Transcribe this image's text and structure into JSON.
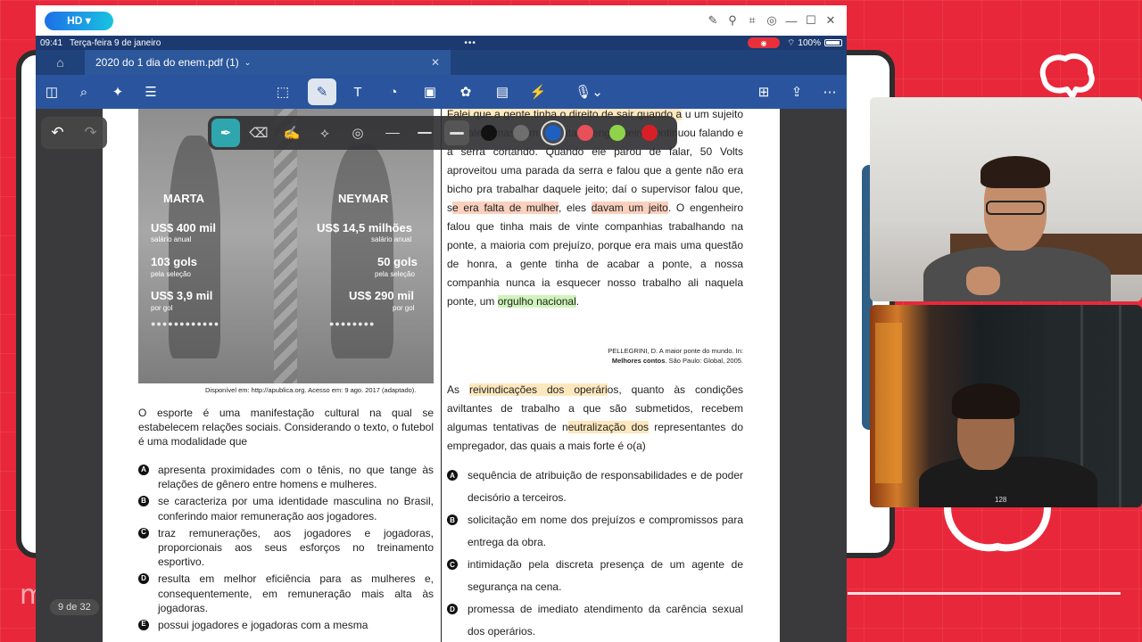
{
  "window": {
    "hd_badge": "HD ▾"
  },
  "statusbar": {
    "time": "09:41",
    "date": "Terça-feira 9 de janeiro",
    "battery": "100%"
  },
  "tab": {
    "title": "2020 do 1 dia do enem.pdf (1)"
  },
  "page_indicator": "9 de 32",
  "figure": {
    "left_name": "MARTA",
    "right_name": "NEYMAR",
    "left_salary": "US$ 400 mil",
    "left_salary_sub": "salário anual",
    "left_goals": "103 gols",
    "left_goals_sub": "pela seleção",
    "left_per_goal": "US$ 3,9 mil",
    "left_per_goal_sub": "por gol",
    "right_salary": "US$ 14,5 milhões",
    "right_salary_sub": "salário anual",
    "right_goals": "50 gols",
    "right_goals_sub": "pela seleção",
    "right_per_goal": "US$ 290 mil",
    "right_per_goal_sub": "por gol",
    "caption": "Disponível em: http://apublica.org. Acesso em: 9 ago. 2017 (adaptado)."
  },
  "left_question": {
    "stem": "O esporte é uma manifestação cultural na qual se estabelecem relações sociais. Considerando o texto, o futebol é uma modalidade que",
    "options": [
      {
        "letter": "A",
        "text": "apresenta proximidades com o tênis, no que tange às relações de gênero entre homens e mulheres."
      },
      {
        "letter": "B",
        "text": "se caracteriza por uma identidade masculina no Brasil, conferindo maior remuneração aos jogadores."
      },
      {
        "letter": "C",
        "text": "traz remunerações, aos jogadores e jogadoras, proporcionais aos seus esforços no treinamento esportivo."
      },
      {
        "letter": "D",
        "text": "resulta em melhor eficiência para as mulheres e, consequentemente, em remuneração mais alta às jogadoras."
      },
      {
        "letter": "E",
        "text": "possui jogadores e jogadoras com a mesma"
      }
    ]
  },
  "right_text": {
    "p1": "Falei que a gente tinha o direito de sair quando a",
    "p1b": "u um sujeito de paletó mas sem gravata; o engenheiro continuou falando e a serra cortando. Quando ele parou de falar, 50 Volts aproveitou uma parada da serra e falou que a gente não era bicho pra trabalhar daquele jeito; daí o supervisor falou que, s",
    "hl1": "e era falta de mulher",
    "mid1": ", eles ",
    "hl2": "davam um jeito",
    "mid2": ". O engenheiro falou que tinha mais de vinte companhias trabalhando na ponte, a maioria com prejuízo, porque era mais uma questão de honra, a gente tinha de acabar a ponte, a nossa companhia nunca ia esquecer nosso trabalho ali naquela ponte, um ",
    "hl3": "orgulho nacional",
    "end": ".",
    "ref1": "PELLEGRINI, D. A maior ponte do mundo. In:",
    "ref2a": "Melhores contos",
    "ref2b": ". São Paulo: Global, 2005."
  },
  "right_question": {
    "s1": "As ",
    "h1": "reivindicações dos operári",
    "s2": "os, quanto às condições aviltantes de trabalho a que são submetidos, recebem algumas tentativas de n",
    "h2": "eutralização dos",
    "s3": " representantes do empregador, das quais a mais forte é o(a)",
    "options": [
      {
        "letter": "A",
        "text": "sequência de atribuição de responsabilidades e de poder decisório a terceiros."
      },
      {
        "letter": "B",
        "text": "solicitação em nome dos prejuízos e compromissos para entrega da obra."
      },
      {
        "letter": "C",
        "text": "intimidação pela discreta presença de um agente de segurança na cena."
      },
      {
        "letter": "D",
        "text": "promessa de imediato atendimento da carência sexual dos operários."
      }
    ]
  },
  "pen_toolbar": {
    "colors": [
      "#111111",
      "#6e6e6e",
      "#1f5fbf",
      "#e8505a",
      "#8fd34a",
      "#d81f26"
    ],
    "selected_color": "#1f5fbf"
  },
  "webcam2": {
    "text": "128"
  }
}
